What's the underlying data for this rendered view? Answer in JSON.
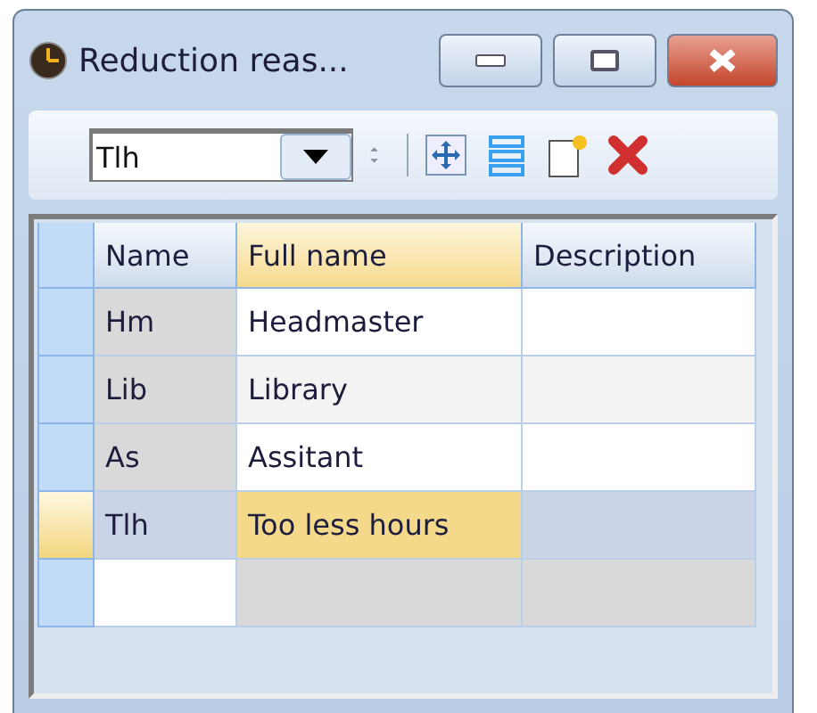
{
  "window": {
    "title": "Reduction reas..."
  },
  "toolbar": {
    "combo_value": "Tlh"
  },
  "table": {
    "columns": [
      {
        "label": "Name",
        "selected": false
      },
      {
        "label": "Full name",
        "selected": true
      },
      {
        "label": "Description",
        "selected": false
      }
    ],
    "rows": [
      {
        "cells": [
          "Hm",
          "Headmaster"
        ],
        "selected": false
      },
      {
        "cells": [
          "Lib",
          "Library"
        ],
        "selected": false
      },
      {
        "cells": [
          "As",
          "Assitant"
        ],
        "selected": false
      },
      {
        "cells": [
          "Tlh",
          "Too less hours"
        ],
        "selected": true
      }
    ],
    "new_row": true
  }
}
